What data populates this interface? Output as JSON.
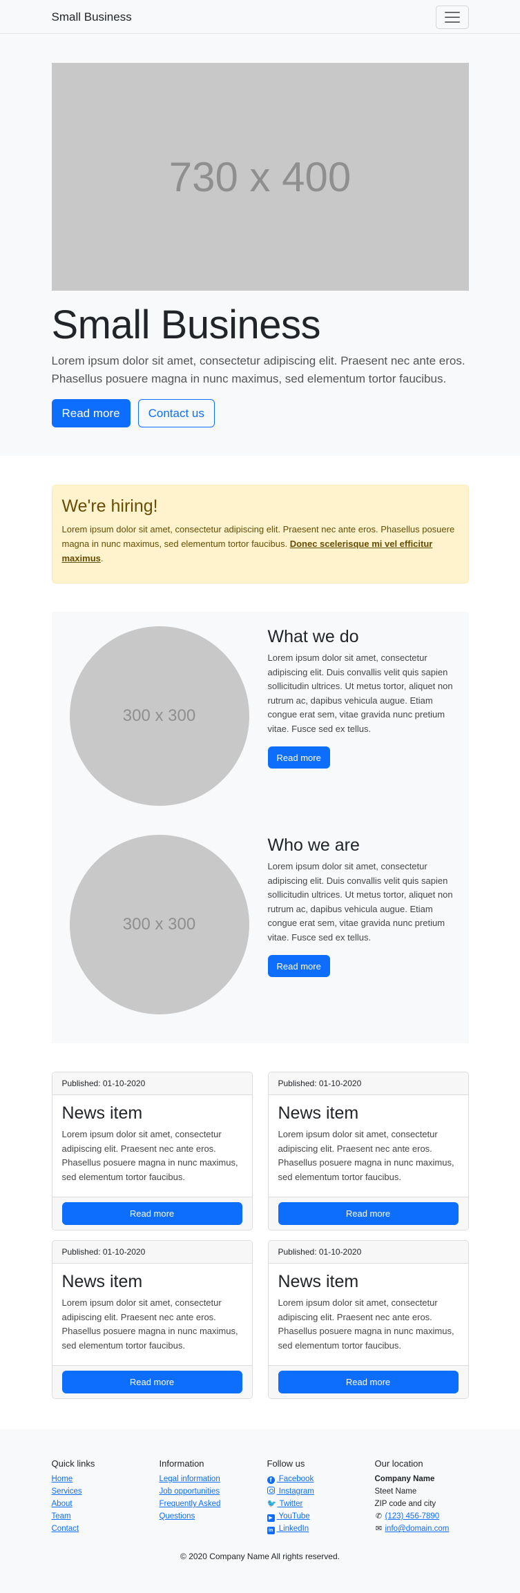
{
  "nav": {
    "brand": "Small Business"
  },
  "hero": {
    "image_text": "730 x 400",
    "title": "Small Business",
    "lead": "Lorem ipsum dolor sit amet, consectetur adipiscing elit. Praesent nec ante eros. Phasellus posuere magna in nunc maximus, sed elementum tortor faucibus.",
    "primary_label": "Read more",
    "secondary_label": "Contact us"
  },
  "alert": {
    "title": "We're hiring!",
    "text": "Lorem ipsum dolor sit amet, consectetur adipiscing elit. Praesent nec ante eros. Phasellus posuere magna in nunc maximus, sed elementum tortor faucibus. ",
    "strong_text": "Donec scelerisque mi vel efficitur maximus",
    "end": "."
  },
  "features": [
    {
      "image_text": "300 x 300",
      "title": "What we do",
      "text": "Lorem ipsum dolor sit amet, consectetur adipiscing elit. Duis convallis velit quis sapien sollicitudin ultrices. Ut metus tortor, aliquet non rutrum ac, dapibus vehicula augue. Etiam congue erat sem, vitae gravida nunc pretium vitae. Fusce sed ex tellus.",
      "button": "Read more"
    },
    {
      "image_text": "300 x 300",
      "title": "Who we are",
      "text": "Lorem ipsum dolor sit amet, consectetur adipiscing elit. Duis convallis velit quis sapien sollicitudin ultrices. Ut metus tortor, aliquet non rutrum ac, dapibus vehicula augue. Etiam congue erat sem, vitae gravida nunc pretium vitae. Fusce sed ex tellus.",
      "button": "Read more"
    }
  ],
  "news": [
    {
      "published": "Published: 01-10-2020",
      "title": "News item",
      "text": "Lorem ipsum dolor sit amet, consectetur adipiscing elit. Praesent nec ante eros. Phasellus posuere magna in nunc maximus, sed elementum tortor faucibus.",
      "button": "Read more"
    },
    {
      "published": "Published: 01-10-2020",
      "title": "News item",
      "text": "Lorem ipsum dolor sit amet, consectetur adipiscing elit. Praesent nec ante eros. Phasellus posuere magna in nunc maximus, sed elementum tortor faucibus.",
      "button": "Read more"
    },
    {
      "published": "Published: 01-10-2020",
      "title": "News item",
      "text": "Lorem ipsum dolor sit amet, consectetur adipiscing elit. Praesent nec ante eros. Phasellus posuere magna in nunc maximus, sed elementum tortor faucibus.",
      "button": "Read more"
    },
    {
      "published": "Published: 01-10-2020",
      "title": "News item",
      "text": "Lorem ipsum dolor sit amet, consectetur adipiscing elit. Praesent nec ante eros. Phasellus posuere magna in nunc maximus, sed elementum tortor faucibus.",
      "button": "Read more"
    }
  ],
  "footer": {
    "quick_links": {
      "title": "Quick links",
      "items": [
        "Home",
        "Services",
        "About",
        "Team",
        "Contact"
      ]
    },
    "information": {
      "title": "Information",
      "items": [
        "Legal information",
        "Job opportunities",
        "Frequently Asked",
        "Questions"
      ]
    },
    "follow": {
      "title": "Follow us",
      "items": [
        {
          "icon": "facebook-icon",
          "label": " Facebook"
        },
        {
          "icon": "instagram-icon",
          "label": " Instagram"
        },
        {
          "icon": "twitter-icon",
          "label": " Twitter"
        },
        {
          "icon": "youtube-icon",
          "label": " YouTube"
        },
        {
          "icon": "linkedin-icon",
          "label": " LinkedIn"
        }
      ]
    },
    "location": {
      "title": "Our location",
      "company": "Company Name",
      "street": "Steet Name",
      "zip": "ZIP code and city",
      "phone": "(123) 456-7890",
      "email": "info@domain.com"
    },
    "copyright": "© 2020 Company Name   All rights reserved."
  },
  "colors": {
    "primary": "#0d6efd",
    "alert_bg": "#fff3cd",
    "alert_text": "#664d03",
    "light_bg": "#f8f9fa",
    "placeholder": "#c8c8c8"
  }
}
